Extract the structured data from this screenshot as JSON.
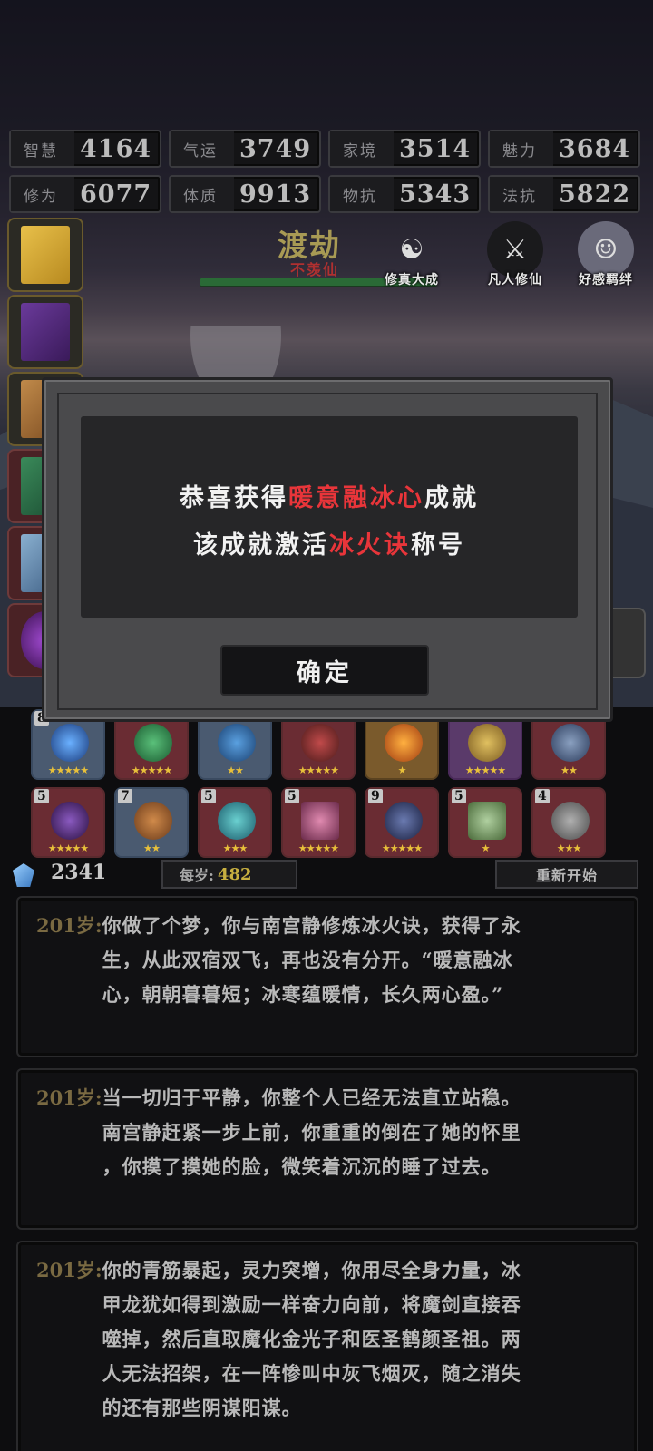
{
  "stats": [
    {
      "name": "智慧",
      "value": "4164"
    },
    {
      "name": "气运",
      "value": "3749"
    },
    {
      "name": "家境",
      "value": "3514"
    },
    {
      "name": "魅力",
      "value": "3684"
    },
    {
      "name": "修为",
      "value": "6077"
    },
    {
      "name": "体质",
      "value": "9913"
    },
    {
      "name": "物抗",
      "value": "5343"
    },
    {
      "name": "法抗",
      "value": "5822"
    }
  ],
  "realm": {
    "title": "渡劫",
    "subtitle": "不羡仙"
  },
  "top_icons": [
    {
      "label": "修真大成",
      "icon": "meditation-icon"
    },
    {
      "label": "凡人修仙",
      "icon": "sword-icon"
    },
    {
      "label": "好感羁绊",
      "icon": "portrait-icon"
    }
  ],
  "items_row1": [
    {
      "level": "8",
      "stars": "★★★★★",
      "color": "blue"
    },
    {
      "level": "",
      "stars": "★★★★★",
      "color": "red"
    },
    {
      "level": "",
      "stars": "★★",
      "color": "blue"
    },
    {
      "level": "",
      "stars": "★★★★★",
      "color": "red"
    },
    {
      "level": "",
      "stars": "★",
      "color": "gold"
    },
    {
      "level": "",
      "stars": "★★★★★",
      "color": "purple"
    },
    {
      "level": "",
      "stars": "★★",
      "color": "red"
    }
  ],
  "items_row2": [
    {
      "level": "5",
      "stars": "★★★★★",
      "color": "red"
    },
    {
      "level": "7",
      "stars": "★★",
      "color": "blue"
    },
    {
      "level": "5",
      "stars": "★★★",
      "color": "red"
    },
    {
      "level": "5",
      "stars": "★★★★★",
      "color": "red"
    },
    {
      "level": "9",
      "stars": "★★★★★",
      "color": "red"
    },
    {
      "level": "5",
      "stars": "★",
      "color": "red"
    },
    {
      "level": "4",
      "stars": "★★★",
      "color": "red"
    }
  ],
  "currency": {
    "value": "2341",
    "per_year_label": "每岁:",
    "per_year_value": "482",
    "restart_label": "重新开始"
  },
  "logs": [
    {
      "age": "201岁:",
      "lines": [
        "你做了个梦，你与南宫静修炼冰火诀，获得了永",
        "生，从此双宿双飞，再也没有分开。“暖意融冰",
        "心，朝朝暮暮短；冰寒蕴暖情，长久两心盈。”"
      ]
    },
    {
      "age": "201岁:",
      "lines": [
        "当一切归于平静，你整个人已经无法直立站稳。",
        "南宫静赶紧一步上前，你重重的倒在了她的怀里",
        "，你摸了摸她的脸，微笑着沉沉的睡了过去。"
      ]
    },
    {
      "age": "201岁:",
      "lines": [
        "你的青筋暴起，灵力突增，你用尽全身力量，冰",
        "甲龙犹如得到激励一样奋力向前，将魔剑直接吞",
        "噬掉，然后直取魔化金光子和医圣鹤颜圣祖。两",
        "人无法招架，在一阵惨叫中灰飞烟灭，随之消失",
        "的还有那些阴谋阳谋。"
      ]
    }
  ],
  "modal": {
    "line1_prefix": "恭喜获得",
    "line1_highlight": "暖意融冰心",
    "line1_suffix": "成就",
    "line2_prefix": "该成就激活",
    "line2_highlight": "冰火诀",
    "line2_suffix": "称号",
    "confirm_label": "确定",
    "highlight_color": "#e8353a"
  }
}
